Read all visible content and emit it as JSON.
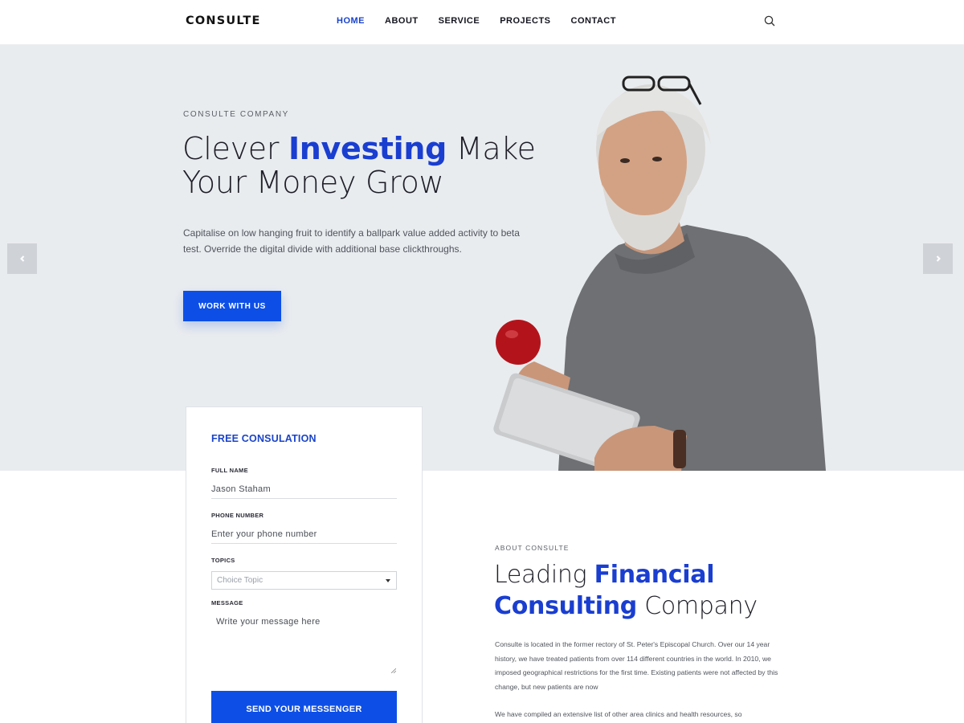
{
  "header": {
    "logo": "CONSULTE",
    "nav": [
      "HOME",
      "ABOUT",
      "SERVICE",
      "PROJECTS",
      "CONTACT"
    ]
  },
  "hero": {
    "eyebrow": "CONSULTE COMPANY",
    "title_pre": "Clever ",
    "title_highlight": "Investing",
    "title_post": " Make Your Money Grow",
    "text": "Capitalise on low hanging fruit to identify a ballpark value added activity to beta test. Override the digital divide with additional base clickthroughs.",
    "cta": "WORK WITH US"
  },
  "form": {
    "title": "FREE CONSULATION",
    "name_label": "FULL NAME",
    "name_value": "Jason Staham",
    "phone_label": "PHONE NUMBER",
    "phone_placeholder": "Enter your phone number",
    "topics_label": "TOPICS",
    "topics_selected": "Choice Topic",
    "message_label": "MESSAGE",
    "message_placeholder": "Write your message here",
    "submit": "SEND YOUR MESSENGER"
  },
  "about": {
    "eyebrow": "ABOUT CONSULTE",
    "title_pre": "Leading ",
    "title_highlight": "Financial Consulting",
    "title_post": " Company",
    "p1": "Consulte is located in the former rectory of St. Peter's Episcopal Church. Over our 14 year history, we have treated patients from over 114 different countries in the world. In 2010, we imposed geographical restrictions for the first time. Existing patients were not affected by this change, but new patients are now",
    "p2": "We have compiled an extensive list of other area clinics and health resources, so"
  },
  "colors": {
    "accent": "#0d4fe6",
    "highlight_text": "#1a3ed0",
    "hero_bg": "#e9ecef"
  }
}
